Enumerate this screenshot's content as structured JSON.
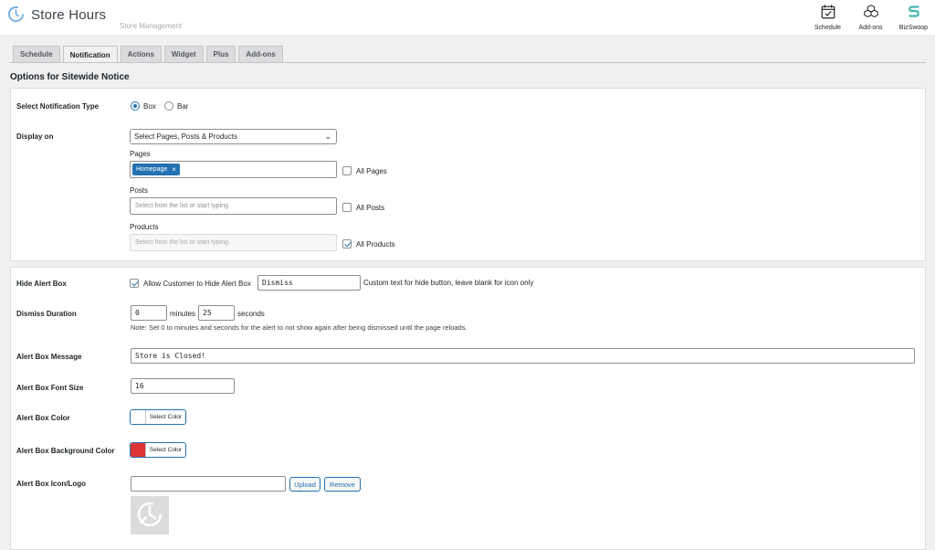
{
  "header": {
    "title": "Store Hours",
    "subtitle": "Store Management",
    "actions": [
      {
        "label": "Schedule",
        "icon": "calendar-check-icon"
      },
      {
        "label": "Add-ons",
        "icon": "cubes-icon"
      },
      {
        "label": "BizSwoop",
        "icon": "bizswoop-logo-icon"
      }
    ]
  },
  "tabs": [
    {
      "label": "Schedule",
      "active": false
    },
    {
      "label": "Notification",
      "active": true
    },
    {
      "label": "Actions",
      "active": false
    },
    {
      "label": "Widget",
      "active": false
    },
    {
      "label": "Plus",
      "active": false
    },
    {
      "label": "Add-ons",
      "active": false
    }
  ],
  "section_title": "Options for Sitewide Notice",
  "notification_type": {
    "label": "Select Notification Type",
    "options": [
      {
        "label": "Box",
        "checked": true
      },
      {
        "label": "Bar",
        "checked": false
      }
    ]
  },
  "display_on": {
    "label": "Display on",
    "select_value": "Select Pages, Posts & Products",
    "pages": {
      "caption": "Pages",
      "tags": [
        "Homepage"
      ],
      "all_label": "All Pages",
      "all_checked": false
    },
    "posts": {
      "caption": "Posts",
      "placeholder": "Select from the list or start typing",
      "all_label": "All Posts",
      "all_checked": false
    },
    "products": {
      "caption": "Products",
      "placeholder": "Select from the list or start typing",
      "all_label": "All Products",
      "all_checked": true
    }
  },
  "hide_alert_box": {
    "label": "Hide Alert Box",
    "checkbox_label": "Allow Customer to Hide Alert Box",
    "checked": true,
    "input_value": "Dismiss",
    "help": "Custom text for hide button, leave blank for icon only"
  },
  "dismiss_duration": {
    "label": "Dismiss Duration",
    "minutes": "0",
    "minutes_label": "minutes",
    "seconds": "25",
    "seconds_label": "seconds",
    "note": "Note: Set 0 to minutes and seconds for the alert to not show again after being dismissed until the page reloads."
  },
  "alert_message": {
    "label": "Alert Box Message",
    "value": "Store is Closed!"
  },
  "alert_font_size": {
    "label": "Alert Box Font Size",
    "value": "16"
  },
  "alert_color": {
    "label": "Alert Box Color",
    "button": "Select Color",
    "swatch": "#ffffff"
  },
  "alert_bg_color": {
    "label": "Alert Box Background Color",
    "button": "Select Color",
    "swatch": "#dd3333"
  },
  "alert_icon": {
    "label": "Alert Box Icon/Logo",
    "value": "",
    "upload": "Upload",
    "remove": "Remove"
  },
  "colors": {
    "accent": "#2271b1",
    "background": "#f0f0f1",
    "brand_teal": "#3db7b0"
  }
}
